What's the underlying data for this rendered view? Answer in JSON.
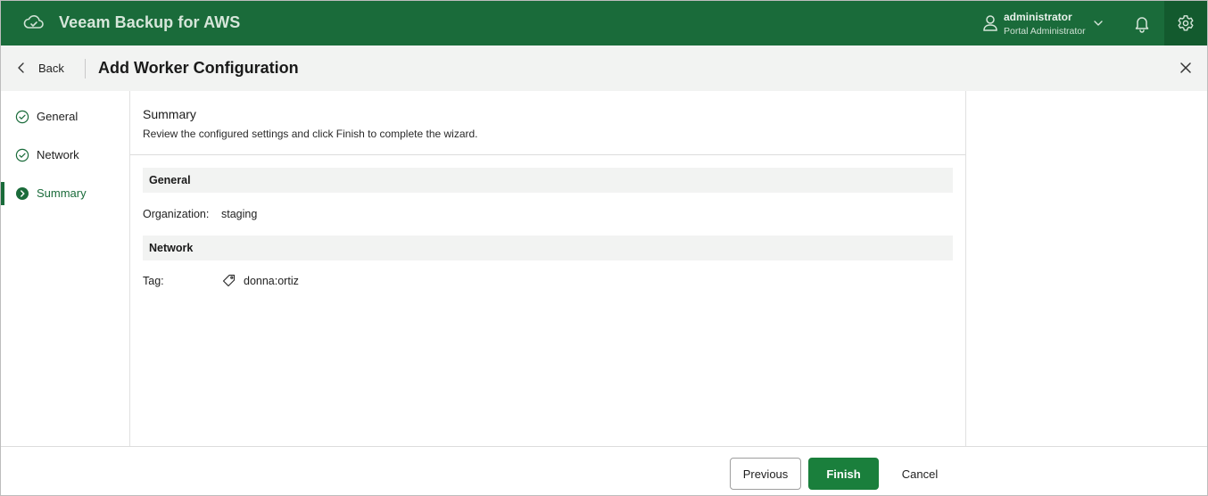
{
  "header": {
    "app_title": "Veeam Backup for AWS",
    "user_name": "administrator",
    "user_role": "Portal Administrator"
  },
  "wizard": {
    "back_label": "Back",
    "title": "Add Worker Configuration"
  },
  "steps": [
    {
      "label": "General",
      "state": "completed"
    },
    {
      "label": "Network",
      "state": "completed"
    },
    {
      "label": "Summary",
      "state": "active"
    }
  ],
  "summary": {
    "heading": "Summary",
    "description": "Review the configured settings and click Finish to complete the wizard.",
    "groups": [
      {
        "title": "General",
        "fields": [
          {
            "label": "Organization:",
            "value": "staging"
          }
        ]
      },
      {
        "title": "Network",
        "fields": [
          {
            "label": "Tag:",
            "value": "donna:ortiz",
            "icon": "tag-icon"
          }
        ]
      }
    ]
  },
  "footer": {
    "previous_label": "Previous",
    "finish_label": "Finish",
    "cancel_label": "Cancel"
  },
  "colors": {
    "brand_green": "#1a6b3a",
    "button_green": "#1a7f3c",
    "header_bg": "#f2f3f2"
  }
}
